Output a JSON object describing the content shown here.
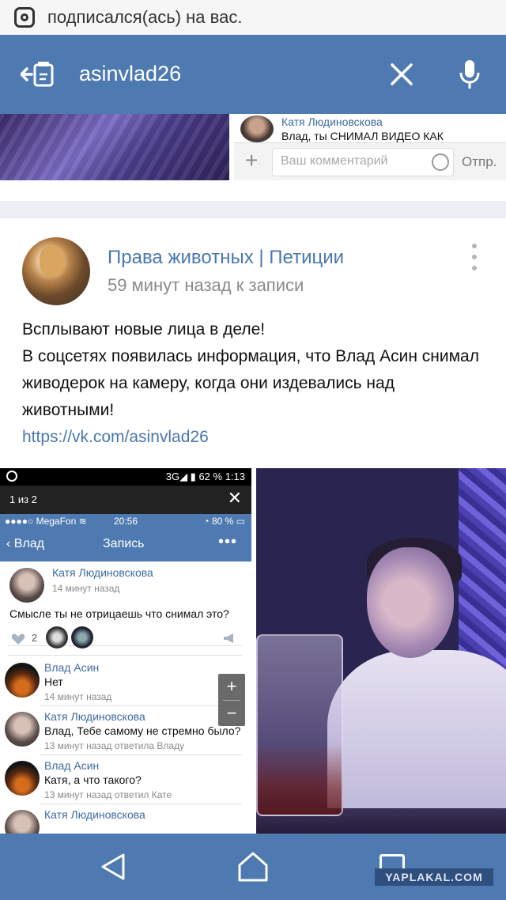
{
  "notification": {
    "icon": "instagram-icon",
    "text": "подписался(ась) на вас."
  },
  "search": {
    "query": "asinvlad26"
  },
  "previous_post": {
    "comment_author": "Катя Людиновскова",
    "comment_text": "Влад,  ты СНИМАЛ ВИДЕО КАК",
    "comment_placeholder": "Ваш комментарий",
    "send_label": "Отпр."
  },
  "post": {
    "group_name": "Права животных | Петиции",
    "time": "59 минут назад к записи",
    "text_lines": [
      "Всплывают новые лица в деле!",
      "В соцсетях появилась информация, что Влад Асин снимал живодерок на камеру, когда они издевались над животными!"
    ],
    "link": "https://vk.com/asinvlad26"
  },
  "embedded_screenshot": {
    "status_right": "3G◢ ▮ 62 %  1:13",
    "viewer_counter": "1 из 2",
    "ios_carrier": "●●●●○ MegaFon ≋",
    "ios_time": "20:56",
    "ios_battery": "◔ 80 % ▭",
    "nav_back": "‹ Влад",
    "nav_title": "Запись",
    "nav_more": "•••",
    "post_author": "Катя Людиновскова",
    "post_time": "14 минут назад",
    "post_text": "Смысле ты не отрицаешь что снимал это?",
    "likes": "2",
    "comments": [
      {
        "author": "Влад Асин",
        "text": "Нет",
        "meta": "14 минут назад",
        "avatar": "vlad"
      },
      {
        "author": "Катя Людиновскова",
        "text": "Влад, Тебе самому не стремно было?",
        "meta": "13 минут назад ответила Владу",
        "avatar": "katya"
      },
      {
        "author": "Влад Асин",
        "text": "Катя, а что такого?",
        "meta": "13 минут назад ответил Кате",
        "avatar": "vlad"
      },
      {
        "author": "Катя Людиновскова",
        "text": "",
        "meta": "",
        "avatar": "katya"
      }
    ]
  },
  "watermark": "YAPLAKAL.COM",
  "colors": {
    "vk_blue": "#4e7ab1",
    "link_blue": "#4a77ae"
  }
}
